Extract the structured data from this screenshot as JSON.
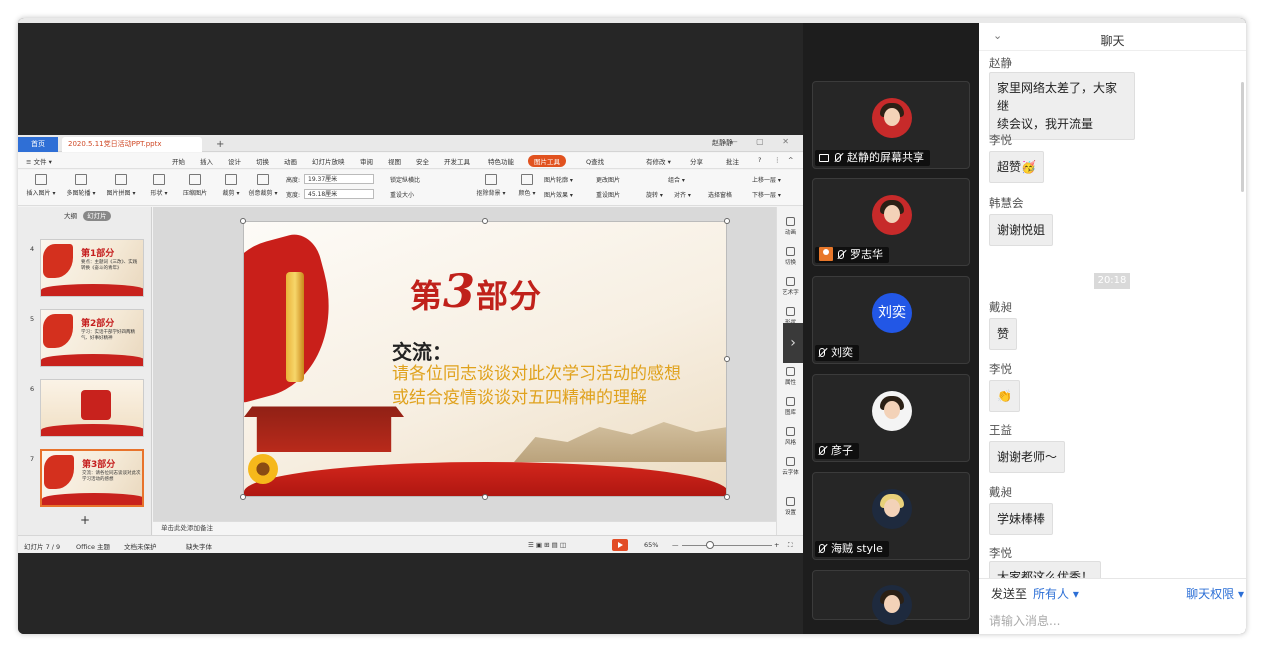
{
  "wps": {
    "tabs": {
      "home": "首页",
      "file": "2020.5.11党日活动PPT.pptx",
      "add": "+"
    },
    "user": "赵静静",
    "menu": [
      "≡ 文件 ▾",
      "开始",
      "插入",
      "设计",
      "切换",
      "动画",
      "幻灯片放映",
      "审阅",
      "视图",
      "安全",
      "开发工具",
      "特色功能"
    ],
    "menu_active": "图片工具",
    "menu_search": "Q查找",
    "menu_right": [
      "有修改 ▾",
      "分享",
      "批注",
      "?",
      "⋮",
      "^"
    ],
    "toolbar": {
      "insert_image": "插入图片 ▾",
      "multi_outline": "多图轮播 ▾",
      "image_split": "图片拼图 ▾",
      "shape": "形状 ▾",
      "compress": "压缩图片",
      "crop": "裁剪 ▾",
      "creative_crop": "创意裁剪 ▾",
      "height_label": "高度:",
      "height_value": "19.37厘米",
      "width_label": "宽度:",
      "width_value": "45.18厘米",
      "lock_ratio": "锁定纵横比",
      "reset_size": "重设大小",
      "matting": "抠除背景 ▾",
      "color": "颜色 ▾",
      "outline": "图片轮廓 ▾",
      "effect": "图片效果 ▾",
      "change": "更改图片",
      "reset": "重设图片",
      "combine": "组合 ▾",
      "rotate": "旋转 ▾",
      "align": "对齐 ▾",
      "select_pane": "选择窗格",
      "up": "上移一层 ▾",
      "down": "下移一层 ▾"
    },
    "view_toggle": {
      "outline": "大纲",
      "slides": "幻灯片"
    },
    "thumbs": [
      {
        "num": "4",
        "title": "第1部分",
        "sub": "要点：主题词《三改》、实践转换《奋斗的青年》"
      },
      {
        "num": "5",
        "title": "第2部分",
        "sub": "学习：实话干部学好四两精气、好事好精神"
      },
      {
        "num": "6",
        "title": "",
        "sub": ""
      },
      {
        "num": "7",
        "title": "第3部分",
        "sub": "交流：请各位同志谈谈对此次学习活动的感想"
      }
    ],
    "slide": {
      "title_pre": "第",
      "title_num": "3",
      "title_post": "部分",
      "heading": "交流：",
      "body": "请各位同志谈谈对此次学习活动的感想或结合疫情谈谈对五四精神的理解"
    },
    "right_panel": [
      "动画",
      "切换",
      "艺术字",
      "形状",
      "图表",
      "属性",
      "图库",
      "风格",
      "云字体",
      "设置"
    ],
    "notes": "单击此处添加备注",
    "status": {
      "slide_count": "幻灯片 7 / 9",
      "theme": "Office 主题",
      "protect": "文档未保护",
      "font": "缺失字体",
      "zoom": "65%"
    }
  },
  "videos": [
    {
      "name": "赵静的屏幕共享",
      "type": "share",
      "avatar": "red"
    },
    {
      "name": "罗志华",
      "type": "host",
      "avatar": "red"
    },
    {
      "name": "刘奕",
      "type": "mic",
      "avatar": "blue",
      "initials": "刘奕"
    },
    {
      "name": "彦子",
      "type": "mic",
      "avatar": "white"
    },
    {
      "name": "海贼 style",
      "type": "mic",
      "avatar": "dark"
    },
    {
      "name": "",
      "type": "mic",
      "avatar": "dark"
    }
  ],
  "chat": {
    "title": "聊天",
    "time_badge": "20:18",
    "messages": [
      {
        "sender": "赵静",
        "text": "家里网络太差了，大家继\n续会议，我开流量"
      },
      {
        "sender": "李悦",
        "text": "超赞🥳"
      },
      {
        "sender": "韩慧会",
        "text": "谢谢悦姐"
      },
      {
        "sender": "戴昶",
        "text": "赞"
      },
      {
        "sender": "李悦",
        "text": "👏"
      },
      {
        "sender": "王益",
        "text": "谢谢老师～"
      },
      {
        "sender": "戴昶",
        "text": "学妹棒棒"
      },
      {
        "sender": "李悦",
        "text": "大家都这么优秀！"
      }
    ],
    "send_to_label": "发送至",
    "send_target": "所有人 ▾",
    "permission": "聊天权限 ▾",
    "input_placeholder": "请输入消息..."
  }
}
